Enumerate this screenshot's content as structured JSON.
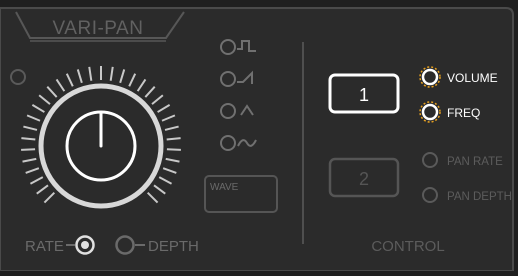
{
  "title": "VARI-PAN",
  "knob": {
    "rate_label": "RATE",
    "depth_label": "DEPTH",
    "tick_count": 33
  },
  "wave": {
    "label": "WAVE",
    "shapes": [
      "square-wave-icon",
      "saw-wave-icon",
      "triangle-wave-icon",
      "sine-wave-icon"
    ]
  },
  "control": {
    "label": "CONTROL",
    "slot1": {
      "value": "1",
      "options": [
        "VOLUME",
        "FREQ"
      ],
      "active": true
    },
    "slot2": {
      "value": "2",
      "options": [
        "PAN RATE",
        "PAN DEPTH"
      ],
      "active": false
    }
  },
  "colors": {
    "background": "#1f1f1f",
    "panel": "#2b2b2b",
    "line": "#4a4a4a",
    "dim_text": "#5c5c5c",
    "knob_outline": "#d8d8d8",
    "active": "#ffffff"
  }
}
